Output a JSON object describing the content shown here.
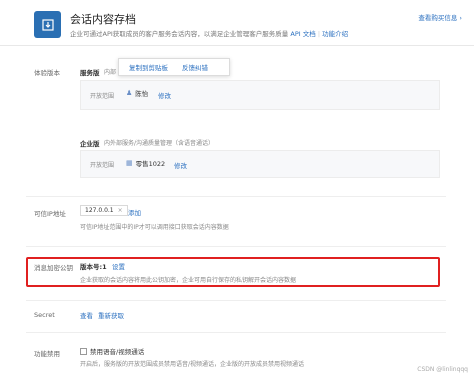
{
  "header": {
    "title": "会话内容存档",
    "description": "企业可通过API获取成员的客户服务会话内容，以满足企业管理客户服务质量",
    "api_doc": "API 文档",
    "intro": "功能介绍",
    "view_purchase": "查看购买信息 ›"
  },
  "popup": {
    "copy": "复制到剪贴板",
    "feedback": "反馈纠错"
  },
  "version": {
    "label": "体验版本",
    "service": {
      "name": "服务版",
      "sub": "内部",
      "scope_label": "开放范围",
      "member": "陈怡",
      "edit": "修改"
    },
    "enterprise": {
      "name": "企业版",
      "desc": "内外部服务/沟通质量管理（含语音通话）",
      "scope_label": "开放范围",
      "member": "零售1022",
      "edit": "修改"
    }
  },
  "ip": {
    "label": "可信IP地址",
    "value": "127.0.0.1",
    "add": "添加",
    "hint": "可信IP地址范围中的IP才可以调用接口获取会话内容数据"
  },
  "encrypt": {
    "label": "消息加密公钥",
    "version": "版本号:1",
    "set": "设置",
    "hint": "企业获取的会话内容将用此公钥加密，企业可用自行保存的私钥解开会话内容数据"
  },
  "secret": {
    "label": "Secret",
    "view": "查看",
    "refresh": "重新获取"
  },
  "feature": {
    "label": "功能禁用",
    "checkbox": "禁用语音/视频通话",
    "hint": "开启后，服务版的开放范围成员禁用语音/视频通话，企业版的开放成员禁用视频通话"
  },
  "watermark": "CSDN @linlinqqq"
}
